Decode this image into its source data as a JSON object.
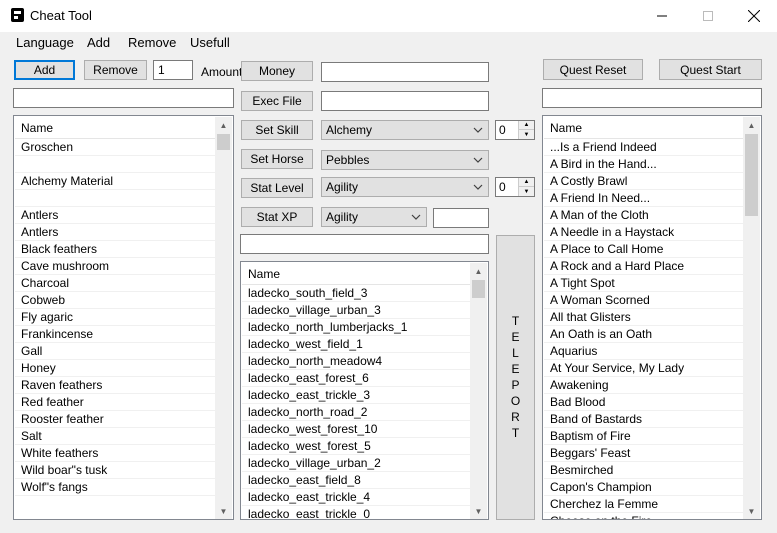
{
  "window": {
    "title": "Cheat Tool",
    "minimize_glyph": "—",
    "maximize_glyph": "☐",
    "close_glyph": "✕"
  },
  "menu": [
    "Language",
    "Add",
    "Remove",
    "Usefull"
  ],
  "left_panel": {
    "add_label": "Add",
    "remove_label": "Remove",
    "amount_value": "1",
    "amount_label": "Amount",
    "filter_value": "",
    "list_header": "Name",
    "items": [
      "Groschen",
      "",
      "Alchemy Material",
      "",
      "Antlers",
      "Antlers",
      "Black feathers",
      "Cave mushroom",
      "Charcoal",
      "Cobweb",
      "Fly agaric",
      "Frankincense",
      "Gall",
      "Honey",
      "Raven feathers",
      "Red feather",
      "Rooster feather",
      "Salt",
      "White feathers",
      "Wild boar\"s tusk",
      "Wolf\"s fangs"
    ]
  },
  "middle_panel": {
    "money_label": "Money",
    "money_value": "",
    "exec_file_label": "Exec File",
    "exec_file_value": "",
    "set_skill_label": "Set Skill",
    "skill_selected": "Alchemy",
    "skill_value": "0",
    "set_horse_label": "Set Horse",
    "horse_selected": "Pebbles",
    "stat_level_label": "Stat Level",
    "stat_selected": "Agility",
    "stat_value": "0",
    "stat_xp_label": "Stat XP",
    "stat_xp_selected": "Agility",
    "stat_xp_value": "",
    "filter_value": "",
    "list_header": "Name",
    "locations": [
      "ladecko_south_field_3",
      "ladecko_village_urban_3",
      "ladecko_north_lumberjacks_1",
      "ladecko_west_field_1",
      "ladecko_north_meadow4",
      "ladecko_east_forest_6",
      "ladecko_east_trickle_3",
      "ladecko_north_road_2",
      "ladecko_west_forest_10",
      "ladecko_west_forest_5",
      "ladecko_village_urban_2",
      "ladecko_east_field_8",
      "ladecko_east_trickle_4",
      "ladecko_east_trickle_0"
    ],
    "teleport_label": "TELEPORT"
  },
  "right_panel": {
    "quest_reset_label": "Quest Reset",
    "quest_start_label": "Quest Start",
    "filter_value": "",
    "list_header": "Name",
    "quests": [
      "...Is a Friend Indeed",
      "A Bird in the Hand...",
      "A Costly Brawl",
      "A Friend In Need...",
      "A Man of the Cloth",
      "A Needle in a Haystack",
      "A Place to Call Home",
      "A Rock and a Hard Place",
      "A Tight Spot",
      "A Woman Scorned",
      "All that Glisters",
      "An Oath is an Oath",
      "Aquarius",
      "At Your Service, My Lady",
      "Awakening",
      "Bad Blood",
      "Band of Bastards",
      "Baptism of Fire",
      "Beggars' Feast",
      "Besmirched",
      "Capon's Champion",
      "Cherchez la Femme",
      "Cheese on the Fire"
    ]
  }
}
